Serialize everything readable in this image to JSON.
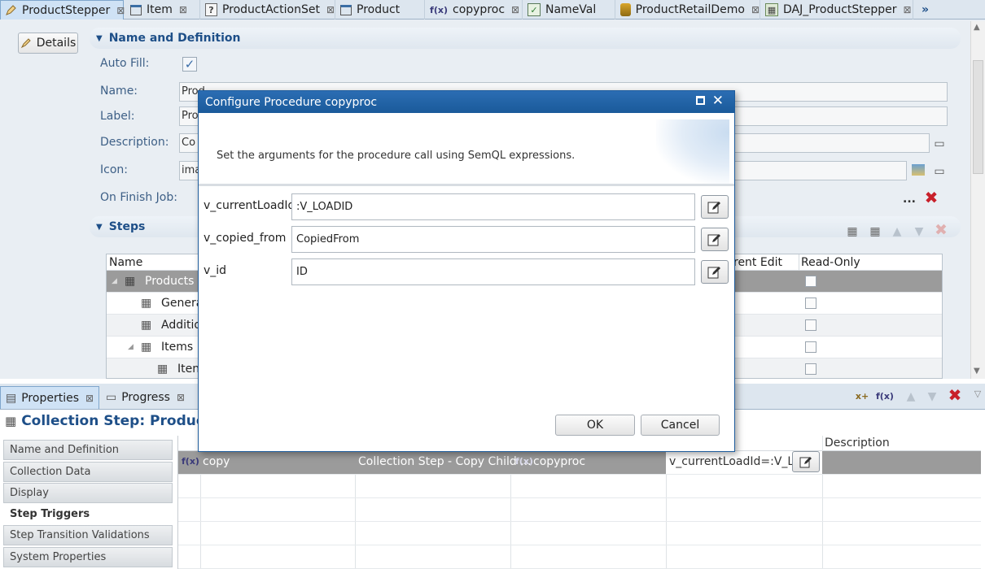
{
  "tabs": [
    {
      "label": "ProductStepper",
      "icon": "pencil-icon",
      "closable": true,
      "active": true
    },
    {
      "label": "Item",
      "icon": "entity-icon",
      "closable": true
    },
    {
      "label": "ProductActionSet",
      "icon": "action-set-icon",
      "closable": true
    },
    {
      "label": "Product",
      "icon": "entity-icon",
      "closable": false
    },
    {
      "label": "copyproc",
      "icon": "function-icon",
      "icon_text": "f(x)",
      "closable": true
    },
    {
      "label": "NameVal",
      "icon": "validation-icon",
      "closable": false
    },
    {
      "label": "ProductRetailDemo",
      "icon": "database-icon",
      "closable": true
    },
    {
      "label": "DAJ_ProductStepper",
      "icon": "job-icon",
      "closable": true
    }
  ],
  "overflow_label": "»",
  "details_button": "Details",
  "name_section": {
    "title": "Name and Definition",
    "fields": {
      "auto_fill": "Auto Fill:",
      "name": "Name:",
      "name_value": "Prod",
      "label": "Label:",
      "label_value": "Pro",
      "description": "Description:",
      "description_value": "Co",
      "icon": "Icon:",
      "icon_value": "ima",
      "on_finish_job": "On Finish Job:",
      "on_finish_more": "..."
    },
    "auto_fill_checked": true
  },
  "steps_section": {
    "title": "Steps",
    "columns": {
      "name": "Name",
      "current_edit": "rent Edit",
      "read_only": "Read-Only"
    },
    "rows": [
      {
        "label": "Products",
        "level": 0,
        "expander": "◢",
        "selected": true
      },
      {
        "label": "Genera",
        "level": 1
      },
      {
        "label": "Additio",
        "level": 1
      },
      {
        "label": "Items",
        "level": 1,
        "expander": "◢"
      },
      {
        "label": "Iten",
        "level": 2
      }
    ]
  },
  "bottom": {
    "tabs": [
      {
        "label": "Properties",
        "active": true,
        "closable": true
      },
      {
        "label": "Progress",
        "closable": true
      }
    ],
    "title": "Collection Step: Products",
    "nav": [
      {
        "label": "Name and Definition"
      },
      {
        "label": "Collection Data"
      },
      {
        "label": "Display"
      },
      {
        "label": "Step Triggers",
        "active": true
      },
      {
        "label": "Step Transition Validations"
      },
      {
        "label": "System Properties"
      }
    ],
    "table": {
      "description_header": "Description",
      "row": {
        "icon": "f(x)",
        "name": "copy",
        "type": "Collection Step - Copy Child ...",
        "procedure_icon": "f(x)",
        "procedure": "copyproc",
        "arguments": "v_currentLoadId=:V_LO"
      }
    }
  },
  "dialog": {
    "title": "Configure Procedure copyproc",
    "message": "Set the arguments for the procedure call using SemQL expressions.",
    "args": [
      {
        "name": "v_currentLoadId",
        "value": ":V_LOADID"
      },
      {
        "name": "v_copied_from",
        "value": "CopiedFrom"
      },
      {
        "name": "v_id",
        "value": "ID"
      }
    ],
    "ok": "OK",
    "cancel": "Cancel"
  },
  "colors": {
    "accent": "#1e4f88",
    "title_bar": "#1a5a9a",
    "selected_row": "#9b9b9b",
    "delete": "#c8202a"
  }
}
